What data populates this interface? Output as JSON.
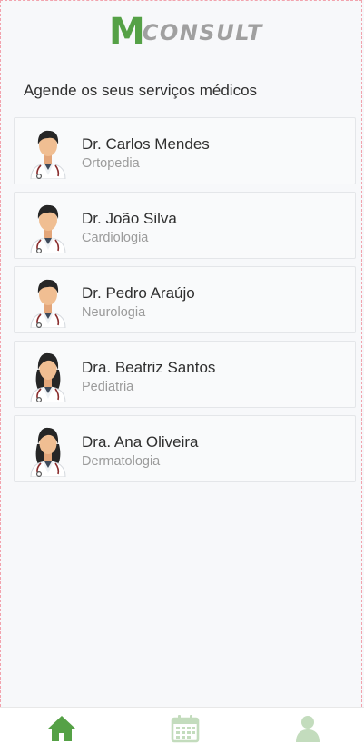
{
  "app": {
    "logo_letter": "M",
    "logo_text": "CONSULT"
  },
  "heading": "Agende os seus serviços médicos",
  "doctors": [
    {
      "name": "Dr. Carlos Mendes",
      "specialty": "Ortopedia",
      "avatar": "male-doctor-icon"
    },
    {
      "name": "Dr. João Silva",
      "specialty": "Cardiologia",
      "avatar": "male-doctor-icon"
    },
    {
      "name": "Dr. Pedro Araújo",
      "specialty": "Neurologia",
      "avatar": "male-doctor-icon"
    },
    {
      "name": "Dra. Beatriz Santos",
      "specialty": "Pediatria",
      "avatar": "female-doctor-icon"
    },
    {
      "name": "Dra. Ana Oliveira",
      "specialty": "Dermatologia",
      "avatar": "female-doctor-icon"
    }
  ],
  "tabs": [
    {
      "icon": "home-icon",
      "active": true
    },
    {
      "icon": "calendar-icon",
      "active": false
    },
    {
      "icon": "user-icon",
      "active": false
    }
  ],
  "colors": {
    "brand_green": "#55a146",
    "inactive_tab": "#c3dcbd",
    "logo_gray": "#a0a0a0"
  }
}
